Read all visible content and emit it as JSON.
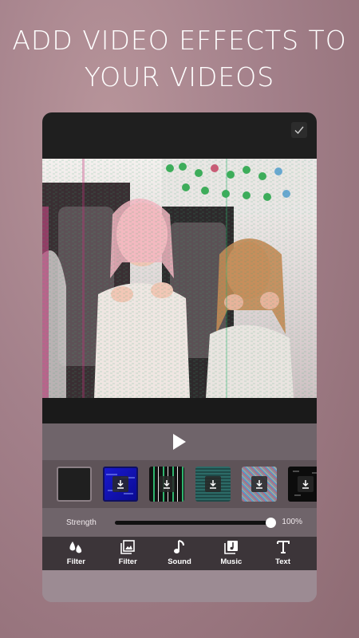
{
  "headline": {
    "line1": "ADD VIDEO EFFECTS TO",
    "line2": "YOUR VIDEOS"
  },
  "colors": {
    "accent": "#ffffff",
    "panel": "#6f646a",
    "tabbar": "#3c3539",
    "background": "#a3808a"
  },
  "editor": {
    "confirm_icon": "check-icon",
    "play_icon": "play-icon",
    "filters": [
      {
        "name": "none",
        "selected": true,
        "download": false
      },
      {
        "name": "blue-glitch",
        "selected": false,
        "download": true
      },
      {
        "name": "green-lines",
        "selected": false,
        "download": true
      },
      {
        "name": "teal-noise",
        "selected": false,
        "download": true
      },
      {
        "name": "rgb-noise",
        "selected": false,
        "download": true
      },
      {
        "name": "dark-glitch",
        "selected": false,
        "download": true
      }
    ],
    "strength": {
      "label": "Strength",
      "value_text": "100%",
      "value": 1.0
    },
    "tabs": [
      {
        "label": "Filter",
        "icon": "drops-icon"
      },
      {
        "label": "Filter",
        "icon": "image-icon"
      },
      {
        "label": "Sound",
        "icon": "music-note-icon"
      },
      {
        "label": "Music",
        "icon": "music-library-icon"
      },
      {
        "label": "Text",
        "icon": "text-icon"
      }
    ]
  }
}
